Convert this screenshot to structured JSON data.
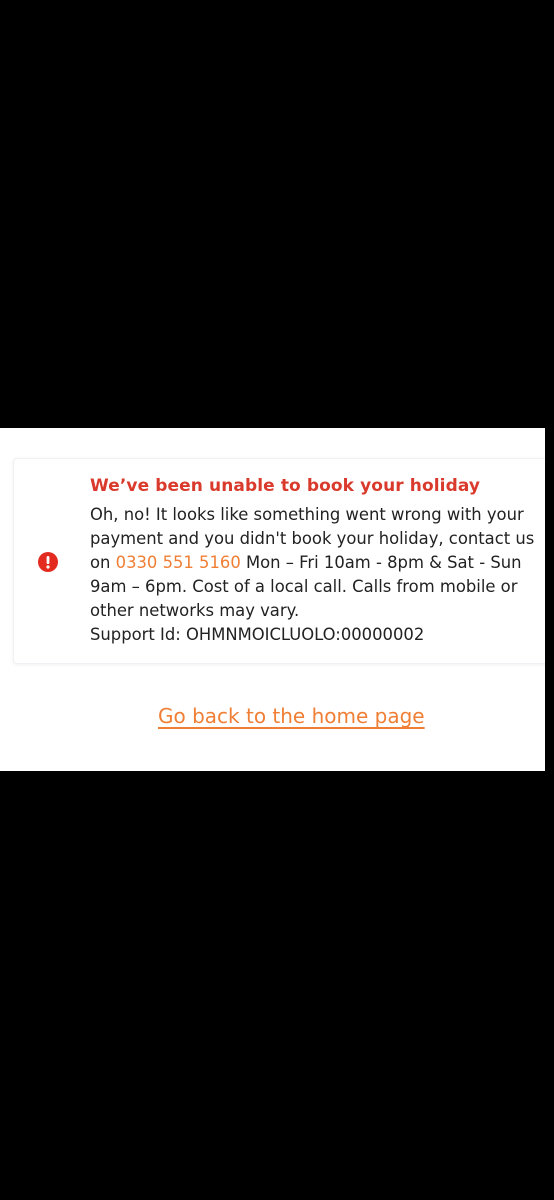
{
  "alert": {
    "icon": "exclamation-circle-icon",
    "icon_color": "#e32b1f",
    "title": "We’ve been unable to book your holiday",
    "title_color": "#d93a2b",
    "body_lines": [
      "Oh, no! It looks like something went wrong with your",
      "payment and you didn't book your holiday, contact us",
      "Mon – Fri 10am - 8pm & Sat - Sun",
      "9am – 6pm. Cost of a local call. Calls from mobile or",
      "other networks may vary.",
      "Support Id: OHMNMOICLUOLO:00000002"
    ],
    "phone_prefix": "on",
    "phone_number": "0330 551 5160",
    "link_color": "#f07f35"
  },
  "home_link": {
    "label": "Go back to the home page"
  }
}
